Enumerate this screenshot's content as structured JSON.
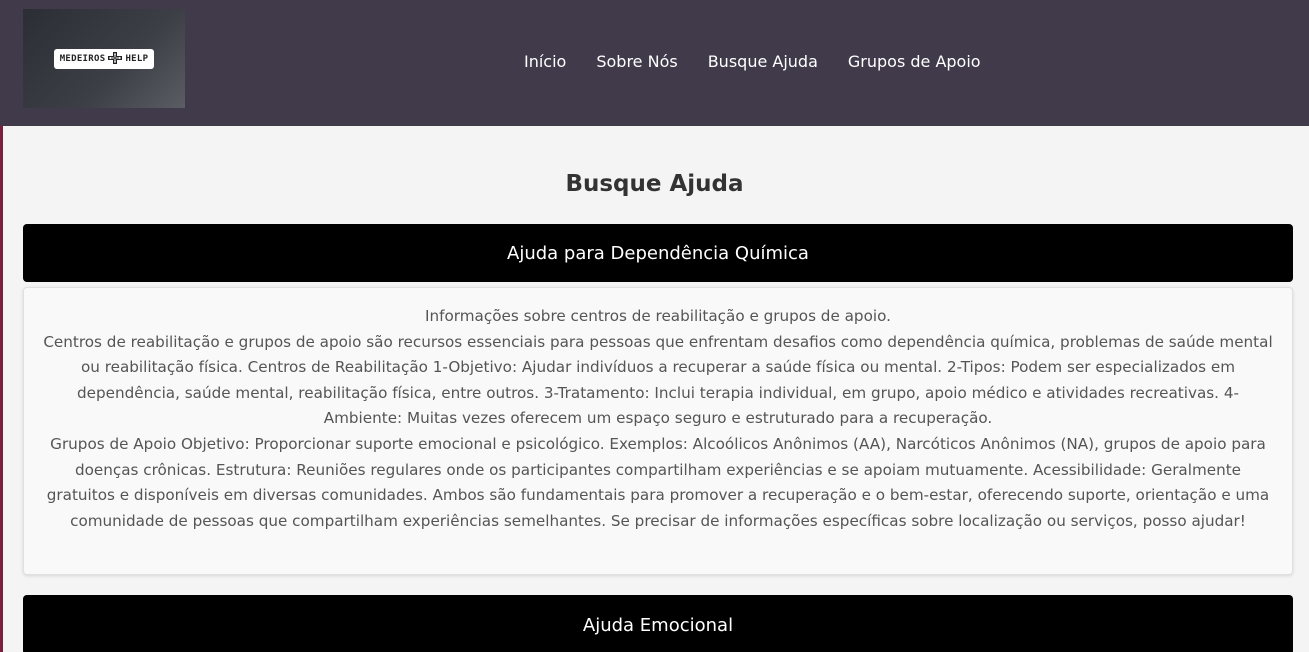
{
  "logo": {
    "left_text": "MEDEIROS",
    "right_text": "HELP",
    "mark_icon": "cross-shield-icon"
  },
  "nav": {
    "items": [
      {
        "label": "Início"
      },
      {
        "label": "Sobre Nós"
      },
      {
        "label": "Busque Ajuda"
      },
      {
        "label": "Grupos de Apoio"
      }
    ]
  },
  "page": {
    "title": "Busque Ajuda"
  },
  "accordion": [
    {
      "title": "Ajuda para Dependência Química",
      "paragraphs": [
        "Informações sobre centros de reabilitação e grupos de apoio.",
        "Centros de reabilitação e grupos de apoio são recursos essenciais para pessoas que enfrentam desafios como dependência química, problemas de saúde mental ou reabilitação física. Centros de Reabilitação 1-Objetivo: Ajudar indivíduos a recuperar a saúde física ou mental. 2-Tipos: Podem ser especializados em dependência, saúde mental, reabilitação física, entre outros. 3-Tratamento: Inclui terapia individual, em grupo, apoio médico e atividades recreativas. 4-Ambiente: Muitas vezes oferecem um espaço seguro e estruturado para a recuperação.",
        "Grupos de Apoio Objetivo: Proporcionar suporte emocional e psicológico. Exemplos: Alcoólicos Anônimos (AA), Narcóticos Anônimos (NA), grupos de apoio para doenças crônicas. Estrutura: Reuniões regulares onde os participantes compartilham experiências e se apoiam mutuamente. Acessibilidade: Geralmente gratuitos e disponíveis em diversas comunidades. Ambos são fundamentais para promover a recuperação e o bem-estar, oferecendo suporte, orientação e uma comunidade de pessoas que compartilham experiências semelhantes. Se precisar de informações específicas sobre localização ou serviços, posso ajudar!"
      ]
    },
    {
      "title": "Ajuda Emocional"
    }
  ],
  "colors": {
    "header_bg": "#403a4a",
    "accordion_header_bg": "#000000",
    "page_bg": "#f4f4f4",
    "left_accent": "#7a1f3d"
  }
}
